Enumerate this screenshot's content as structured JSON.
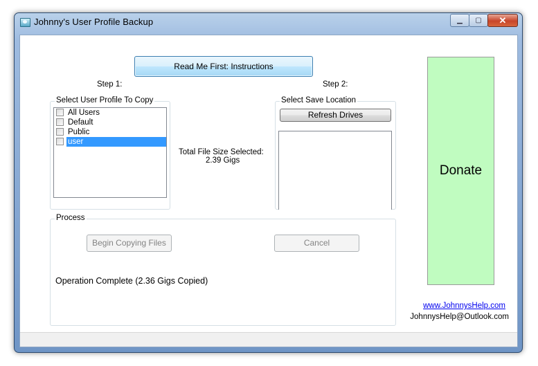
{
  "window": {
    "title": "Johnny's User Profile Backup",
    "caption_buttons": {
      "minimize": "▁",
      "maximize": "▢",
      "close": "✕"
    }
  },
  "header": {
    "readme_label": "Read Me First:  Instructions",
    "step1_label": "Step 1:",
    "step2_label": "Step 2:"
  },
  "profiles": {
    "title": "Select User Profile To Copy",
    "items": [
      {
        "label": "All Users",
        "checked": false,
        "selected": false
      },
      {
        "label": "Default",
        "checked": false,
        "selected": false
      },
      {
        "label": "Public",
        "checked": false,
        "selected": false
      },
      {
        "label": "user",
        "checked": false,
        "selected": true
      }
    ]
  },
  "size_info": {
    "label": "Total File Size Selected:",
    "value": "2.39 Gigs"
  },
  "save_location": {
    "title": "Select Save Location",
    "refresh_label": "Refresh Drives",
    "drives": []
  },
  "process": {
    "title": "Process",
    "begin_label": "Begin Copying Files",
    "cancel_label": "Cancel",
    "status_message": "Operation Complete (2.36 Gigs Copied)"
  },
  "donate_label": "Donate",
  "contact": {
    "website": "www.JohnnysHelp.com",
    "email": "JohnnysHelp@Outlook.com"
  },
  "colors": {
    "donate_bg": "#c0fcc0",
    "selection": "#3399ff",
    "link": "#0000ee"
  }
}
